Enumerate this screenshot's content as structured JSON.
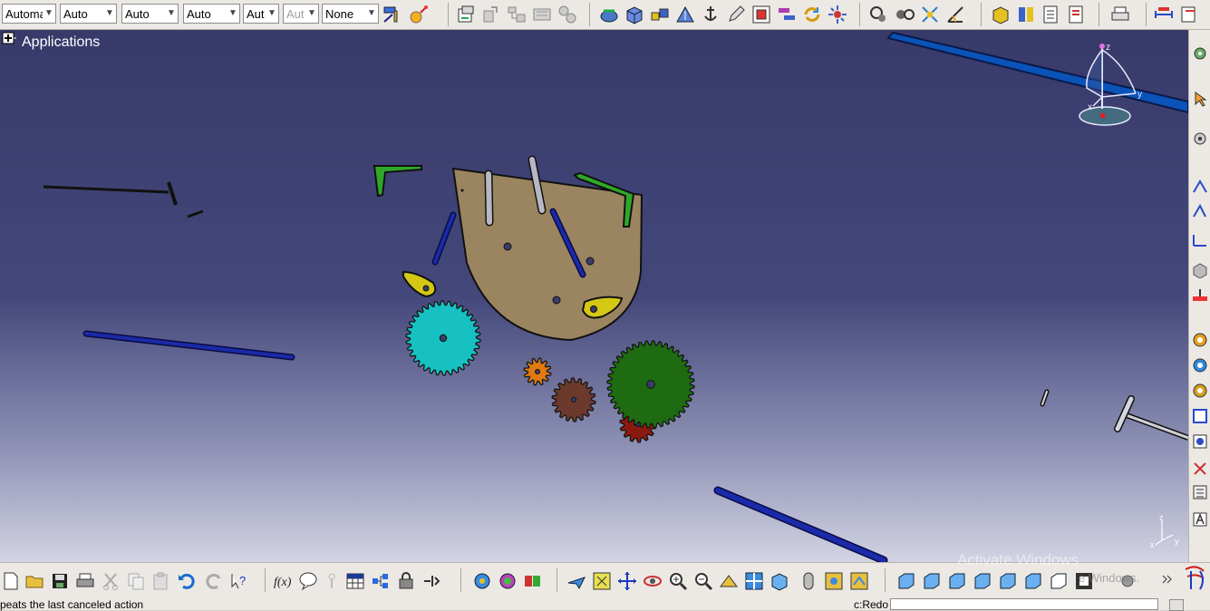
{
  "toolbar_top": {
    "combos": [
      {
        "value": "Automa"
      },
      {
        "value": "Auto"
      },
      {
        "value": "Auto"
      },
      {
        "value": "Auto"
      },
      {
        "value": "Aut"
      },
      {
        "value": "Aut"
      },
      {
        "value": "None"
      }
    ]
  },
  "spec_tree": {
    "root_label": "Applications"
  },
  "compass": {
    "axis_z": "z",
    "axis_y": "y",
    "axis_x": "x"
  },
  "mini_axis": {
    "z": "z",
    "x": "x",
    "y": "y"
  },
  "watermark": {
    "line1": "Activate Windows",
    "line2": "e Windows."
  },
  "status_bar": {
    "message": "peats the last canceled action",
    "command_label": "c:Redo"
  },
  "colors": {
    "viewport_top": "#383a6a",
    "viewport_bottom": "#d2d3e3",
    "plate": "#9b8560",
    "gear_cyan": "#17c1c1",
    "gear_green": "#1e6b12",
    "gear_orange": "#e07a10",
    "gear_brown": "#6b3a2c",
    "link_green": "#2fa82a",
    "link_yellow": "#d4c814",
    "rod_blue": "#1a2aa8"
  }
}
